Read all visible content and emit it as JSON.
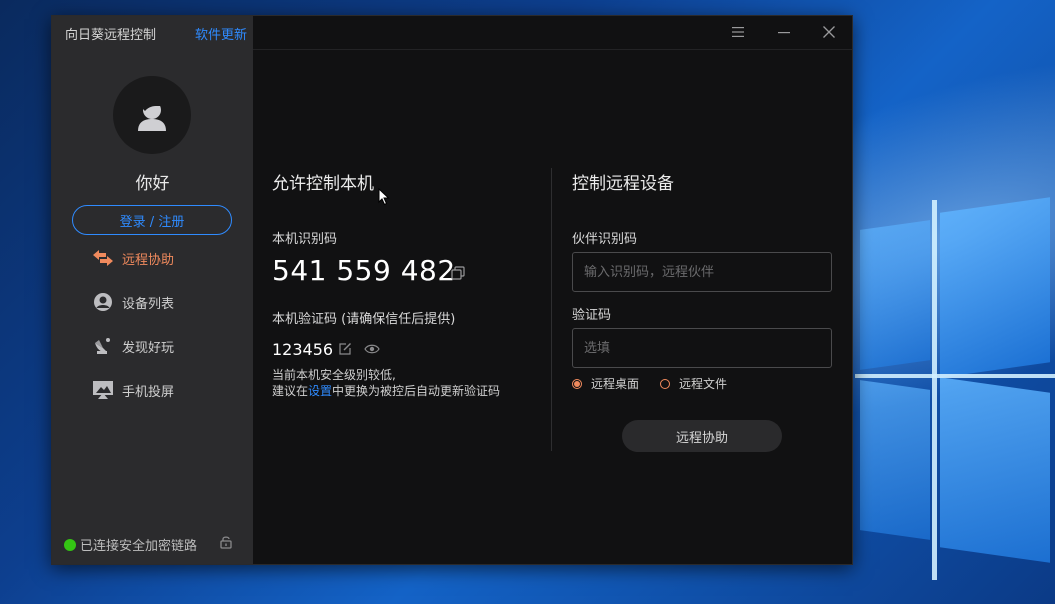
{
  "app": {
    "title": "向日葵远程控制",
    "update_link": "软件更新"
  },
  "sidebar": {
    "greeting": "你好",
    "login_label": "登录 / 注册",
    "items": [
      {
        "label": "远程协助",
        "icon": "remote-assist-icon",
        "active": true
      },
      {
        "label": "设备列表",
        "icon": "device-list-icon",
        "active": false
      },
      {
        "label": "发现好玩",
        "icon": "discover-icon",
        "active": false
      },
      {
        "label": "手机投屏",
        "icon": "screen-cast-icon",
        "active": false
      }
    ],
    "status": "已连接安全加密链路"
  },
  "local": {
    "title": "允许控制本机",
    "id_label": "本机识别码",
    "id_value": "541 559 482",
    "code_label": "本机验证码 (请确保信任后提供)",
    "code_value": "123456",
    "note_line1": "当前本机安全级别较低,",
    "note_prefix": "建议在",
    "note_link": "设置",
    "note_suffix": "中更换为被控后自动更新验证码"
  },
  "remote": {
    "title": "控制远程设备",
    "partner_label": "伙伴识别码",
    "partner_placeholder": "输入识别码，远程伙伴",
    "code_label": "验证码",
    "code_placeholder": "选填",
    "options": [
      "远程桌面",
      "远程文件"
    ],
    "selected": "远程桌面",
    "button_label": "远程协助"
  },
  "colors": {
    "accent_blue": "#2f8bff",
    "accent_orange": "#f08a5d",
    "status_green": "#34c414"
  }
}
